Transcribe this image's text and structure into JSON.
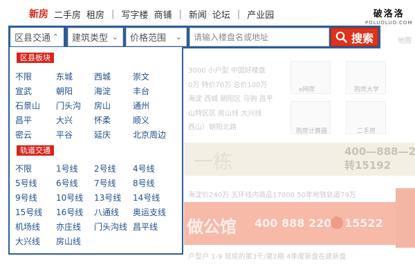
{
  "nav": {
    "items": [
      "新房",
      "二手房",
      "租房",
      "写字楼",
      "商铺",
      "新闻",
      "论坛",
      "产业园"
    ],
    "separator": "|"
  },
  "logo": {
    "main": "破洛洛",
    "sub": "POLUOLUO.COM"
  },
  "search": {
    "district_label": "区县交通",
    "type_label": "建筑类型",
    "price_label": "价格范围",
    "placeholder": "请输入楼盘名或地址",
    "button_label": "搜索"
  },
  "dropdown": {
    "districts_title": "区县板块",
    "districts": [
      "不限",
      "东城",
      "西城",
      "崇文",
      "宣武",
      "朝阳",
      "海淀",
      "丰台",
      "石景山",
      "门头沟",
      "房山",
      "通州",
      "昌平",
      "大兴",
      "怀柔",
      "顺义",
      "密云",
      "平谷",
      "延庆",
      "北京周边"
    ],
    "transit_title": "轨道交通",
    "transit": [
      "不限",
      "1号线",
      "2号线",
      "4号线",
      "5号线",
      "6号线",
      "7号线",
      "8号线",
      "9号线",
      "10号线",
      "13号线",
      "14号线",
      "15号线",
      "16号线",
      "八通线",
      "奥运支线",
      "机场线",
      "亦庄线",
      "门头沟线",
      "昌平线",
      "大兴线",
      "房山线"
    ]
  },
  "background": {
    "map_link": "地图",
    "promo_line1": "3000 小户型 中国好楼盘",
    "promo_line2": "0万 特价70万 总价100万",
    "promo_line3": "海淀 西城 朝阳区 马驹 昌平",
    "promo_line4": "山特区区 房山线 大兴线",
    "promo_line5": "西山）朝阳北路",
    "tiles": [
      "e网房",
      "购房大学",
      "购房计算器",
      "二手房"
    ],
    "ad_phone": "400—888—2",
    "ad_phone2": "转15192",
    "ad_char": "一栋",
    "stats_line": "海淀价240万   五环线内商品17000   50年地铁轨道79万",
    "red_ad_title": "做公馆",
    "red_ad_phone": "400 888 2200",
    "red_ad_ext": "15522",
    "footer_line": "户型户   1-9   现房的第3千/第2期   4季度新盘在建新盘"
  },
  "colors": {
    "accent": "#d8261c",
    "bar": "#2c5d97",
    "link": "#1f4e8c"
  }
}
